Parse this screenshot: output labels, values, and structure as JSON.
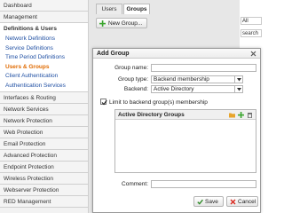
{
  "sidebar": {
    "top_items": [
      "Dashboard",
      "Management"
    ],
    "section": "Definitions & Users",
    "subitems": [
      {
        "label": "Network Definitions",
        "active": false
      },
      {
        "label": "Service Definitions",
        "active": false
      },
      {
        "label": "Time Period Definitions",
        "active": false
      },
      {
        "label": "Users & Groups",
        "active": true
      },
      {
        "label": "Client Authentication",
        "active": false
      },
      {
        "label": "Authentication Services",
        "active": false
      }
    ],
    "bottom_items": [
      "Interfaces & Routing",
      "Network Services",
      "Network Protection",
      "Web Protection",
      "Email Protection",
      "Advanced Protection",
      "Endpoint Protection",
      "Wireless Protection",
      "Webserver Protection",
      "RED Management"
    ]
  },
  "tabs": {
    "users": "Users",
    "groups": "Groups"
  },
  "toolbar": {
    "new_group_label": "New Group..."
  },
  "filter": {
    "selected": "All",
    "search_placeholder": "search"
  },
  "dialog": {
    "title": "Add Group",
    "group_name_label": "Group name:",
    "group_name_value": "",
    "group_type_label": "Group type:",
    "group_type_value": "Backend membership",
    "backend_label": "Backend:",
    "backend_value": "Active Directory",
    "limit_label": "Limit to backend group(s) membership",
    "limit_checked": true,
    "ad_groups_title": "Active Directory Groups",
    "comment_label": "Comment:",
    "comment_value": "",
    "save_label": "Save",
    "cancel_label": "Cancel"
  },
  "colors": {
    "accent_orange": "#e06a00",
    "link_blue": "#1f4fa3",
    "plus_green": "#3aa52e",
    "cancel_red": "#d9261c"
  }
}
